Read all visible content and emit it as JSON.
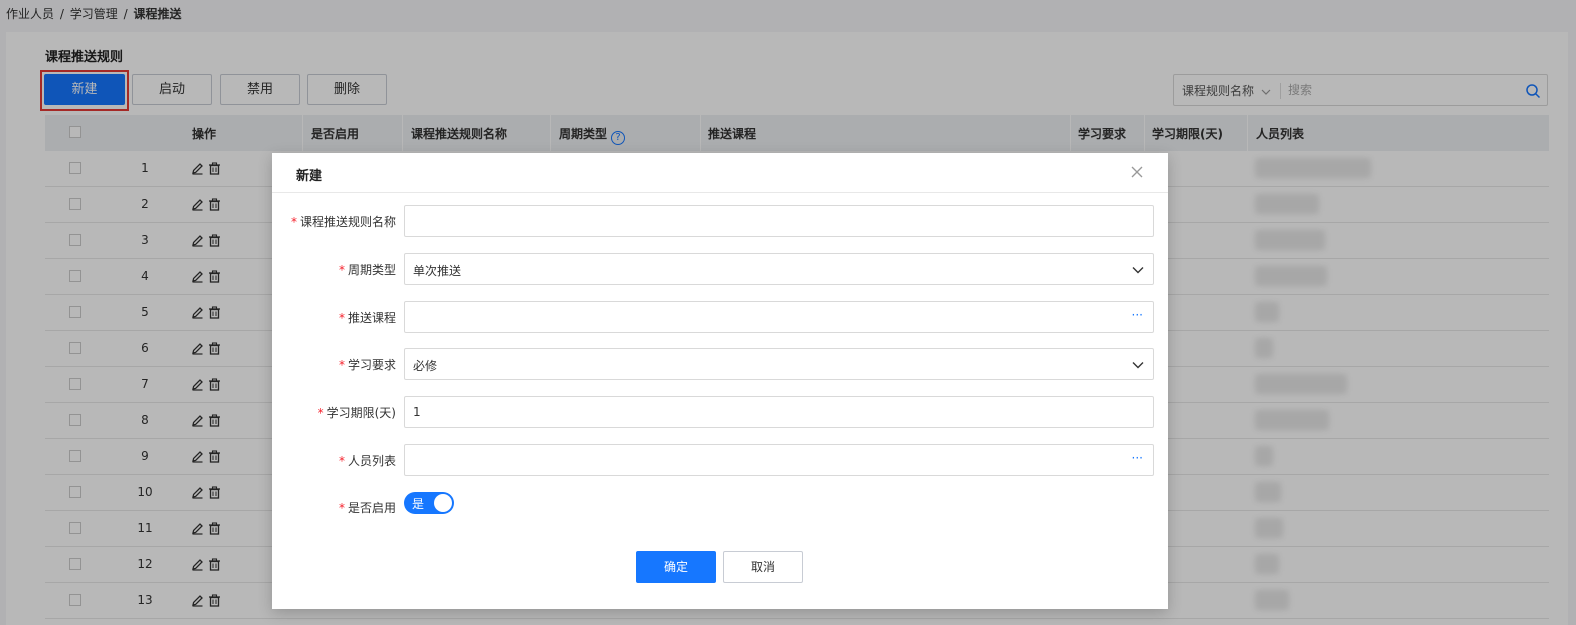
{
  "breadcrumb": [
    "作业人员",
    "学习管理",
    "课程推送"
  ],
  "section_title": "课程推送规则",
  "toolbar": {
    "new_label": "新建",
    "enable_label": "启动",
    "disable_label": "禁用",
    "delete_label": "删除"
  },
  "search": {
    "field_select": "课程规则名称",
    "placeholder": "搜索"
  },
  "table": {
    "columns": [
      "操作",
      "是否启用",
      "课程推送规则名称",
      "周期类型",
      "推送课程",
      "学习要求",
      "学习期限(天)",
      "人员列表"
    ],
    "rows": [
      "1",
      "2",
      "3",
      "4",
      "5",
      "6",
      "7",
      "8",
      "9",
      "10",
      "11",
      "12",
      "13"
    ]
  },
  "modal": {
    "title": "新建",
    "fields": {
      "rule_name": {
        "label": "课程推送规则名称",
        "value": ""
      },
      "cycle_type": {
        "label": "周期类型",
        "value": "单次推送"
      },
      "push_course": {
        "label": "推送课程",
        "value": ""
      },
      "study_requirement": {
        "label": "学习要求",
        "value": "必修"
      },
      "study_deadline": {
        "label": "学习期限(天)",
        "value": "1"
      },
      "person_list": {
        "label": "人员列表",
        "value": ""
      },
      "enabled": {
        "label": "是否启用",
        "value": "是"
      }
    },
    "required_mark": "*",
    "ok_label": "确定",
    "cancel_label": "取消"
  },
  "colors": {
    "primary": "#1677ff",
    "highlight_border": "#e53935",
    "required": "#f5222d"
  }
}
